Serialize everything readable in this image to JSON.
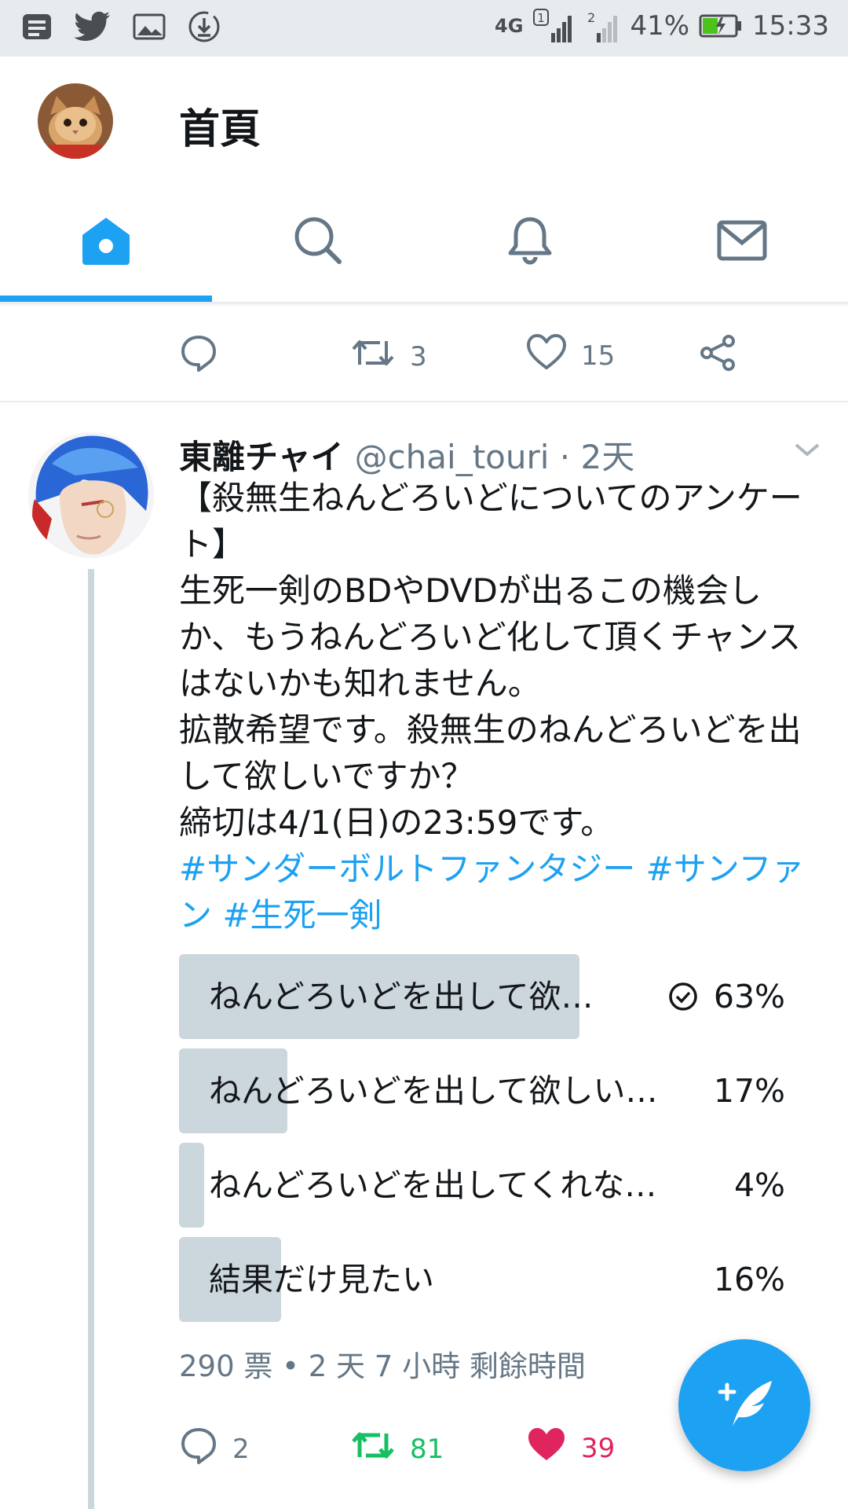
{
  "status_bar": {
    "network": "4G",
    "sim1": "1",
    "sim2": "2",
    "battery": "41%",
    "time": "15:33",
    "left_icons": [
      "notes-icon",
      "twitter-icon",
      "image-icon",
      "download-icon"
    ]
  },
  "header": {
    "title": "首頁",
    "tabs": [
      {
        "name": "home",
        "icon": "home-icon",
        "active": true
      },
      {
        "name": "search",
        "icon": "search-icon",
        "active": false
      },
      {
        "name": "notifications",
        "icon": "bell-icon",
        "active": false
      },
      {
        "name": "messages",
        "icon": "mail-icon",
        "active": false
      }
    ],
    "accent": "#1da1f2"
  },
  "prev_tweet": {
    "retweets": "3",
    "likes": "15"
  },
  "tweet": {
    "name": "東離チャイ",
    "handle": "@chai_touri · 2天",
    "body": "【殺無生ねんどろいどについてのアンケート】\n生死一剣のBDやDVDが出るこの機会しか、もうねんどろいど化して頂くチャンスはないかも知れません。\n拡散希望です。殺無生のねんどろいどを出して欲しいですか？\n締切は4/1(日)の23:59です。",
    "hashtags": "#サンダーボルトファンタジー #サンファン #生死一剣",
    "poll": {
      "options": [
        {
          "label": "ねんどろいどを出して欲…",
          "percent": "63%",
          "value": 63,
          "selected": true
        },
        {
          "label": "ねんどろいどを出して欲しい…",
          "percent": "17%",
          "value": 17,
          "selected": false
        },
        {
          "label": "ねんどろいどを出してくれな…",
          "percent": "4%",
          "value": 4,
          "selected": false
        },
        {
          "label": "結果だけ見たい",
          "percent": "16%",
          "value": 16,
          "selected": false
        }
      ],
      "meta": "290 票 • 2 天 7 小時 剩餘時間"
    },
    "replies": "2",
    "retweets": "81",
    "likes": "39",
    "retweet_color": "#17bf63",
    "like_color": "#e0245e"
  }
}
